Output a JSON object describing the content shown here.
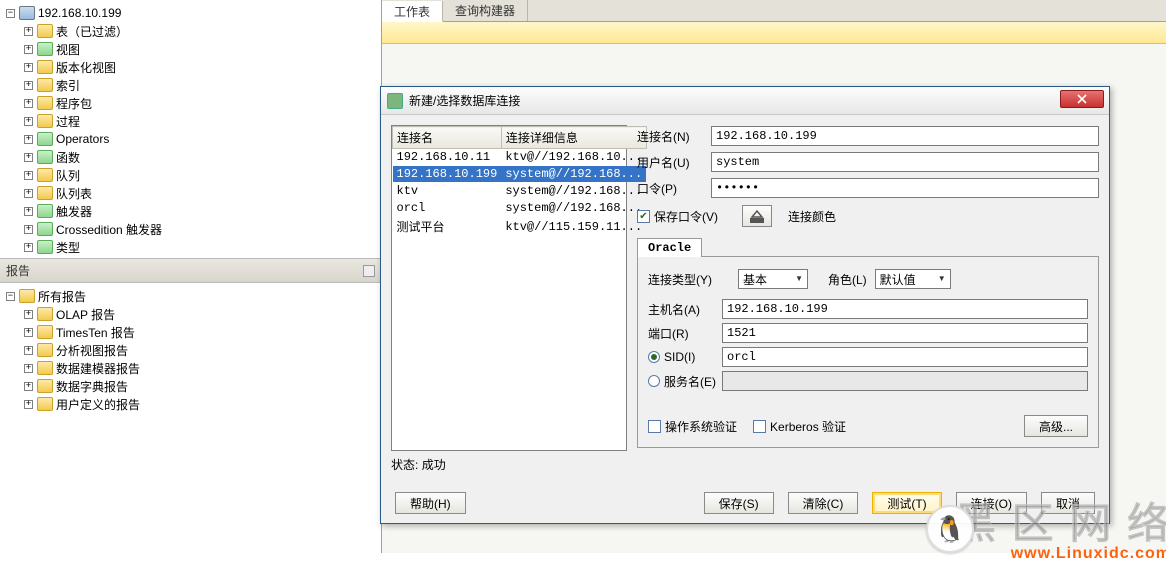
{
  "left_tree": {
    "root": "192.168.10.199",
    "items": [
      {
        "label": "表（已过滤）",
        "icon": "ic-folder"
      },
      {
        "label": "视图",
        "icon": "ic-folder-g"
      },
      {
        "label": "版本化视图",
        "icon": "ic-folder"
      },
      {
        "label": "索引",
        "icon": "ic-folder"
      },
      {
        "label": "程序包",
        "icon": "ic-folder"
      },
      {
        "label": "过程",
        "icon": "ic-folder"
      },
      {
        "label": "Operators",
        "icon": "ic-folder-g"
      },
      {
        "label": "函数",
        "icon": "ic-folder-g"
      },
      {
        "label": "队列",
        "icon": "ic-folder"
      },
      {
        "label": "队列表",
        "icon": "ic-folder"
      },
      {
        "label": "触发器",
        "icon": "ic-folder-g"
      },
      {
        "label": "Crossedition 触发器",
        "icon": "ic-folder-g"
      },
      {
        "label": "类型",
        "icon": "ic-folder-g"
      }
    ]
  },
  "reports": {
    "header": "报告",
    "root": "所有报告",
    "items": [
      {
        "label": "OLAP 报告"
      },
      {
        "label": "TimesTen 报告"
      },
      {
        "label": "分析视图报告"
      },
      {
        "label": "数据建模器报告"
      },
      {
        "label": "数据字典报告"
      },
      {
        "label": "用户定义的报告"
      }
    ]
  },
  "main_tabs": {
    "t1": "工作表",
    "t2": "查询构建器"
  },
  "dialog": {
    "title": "新建/选择数据库连接",
    "table": {
      "h1": "连接名",
      "h2": "连接详细信息",
      "rows": [
        {
          "name": "192.168.10.11",
          "detail": "ktv@//192.168.10..."
        },
        {
          "name": "192.168.10.199",
          "detail": "system@//192.168..."
        },
        {
          "name": "ktv",
          "detail": "system@//192.168..."
        },
        {
          "name": "orcl",
          "detail": "system@//192.168..."
        },
        {
          "name": "测试平台",
          "detail": "ktv@//115.159.11..."
        }
      ],
      "selected_index": 1
    },
    "form": {
      "conn_name_label": "连接名(N)",
      "conn_name": "192.168.10.199",
      "user_label": "用户名(U)",
      "user": "system",
      "pwd_label": "口令(P)",
      "pwd": "••••••",
      "save_pwd": "保存口令(V)",
      "color_label": "连接颜色"
    },
    "tab_label": "Oracle",
    "oracle": {
      "conn_type_label": "连接类型(Y)",
      "conn_type": "基本",
      "role_label": "角色(L)",
      "role": "默认值",
      "host_label": "主机名(A)",
      "host": "192.168.10.199",
      "port_label": "端口(R)",
      "port": "1521",
      "sid_label": "SID(I)",
      "sid": "orcl",
      "service_label": "服务名(E)",
      "os_auth": "操作系统验证",
      "kerberos": "Kerberos 验证",
      "advanced": "高级..."
    },
    "status_label": "状态:",
    "status_value": "成功",
    "buttons": {
      "help": "帮助(H)",
      "save": "保存(S)",
      "clear": "清除(C)",
      "test": "测试(T)",
      "connect": "连接(O)",
      "cancel": "取消"
    }
  },
  "watermark": {
    "big": "黑 区 网 络",
    "url": "www.Linuxidc.com",
    "penguin": "🐧"
  }
}
